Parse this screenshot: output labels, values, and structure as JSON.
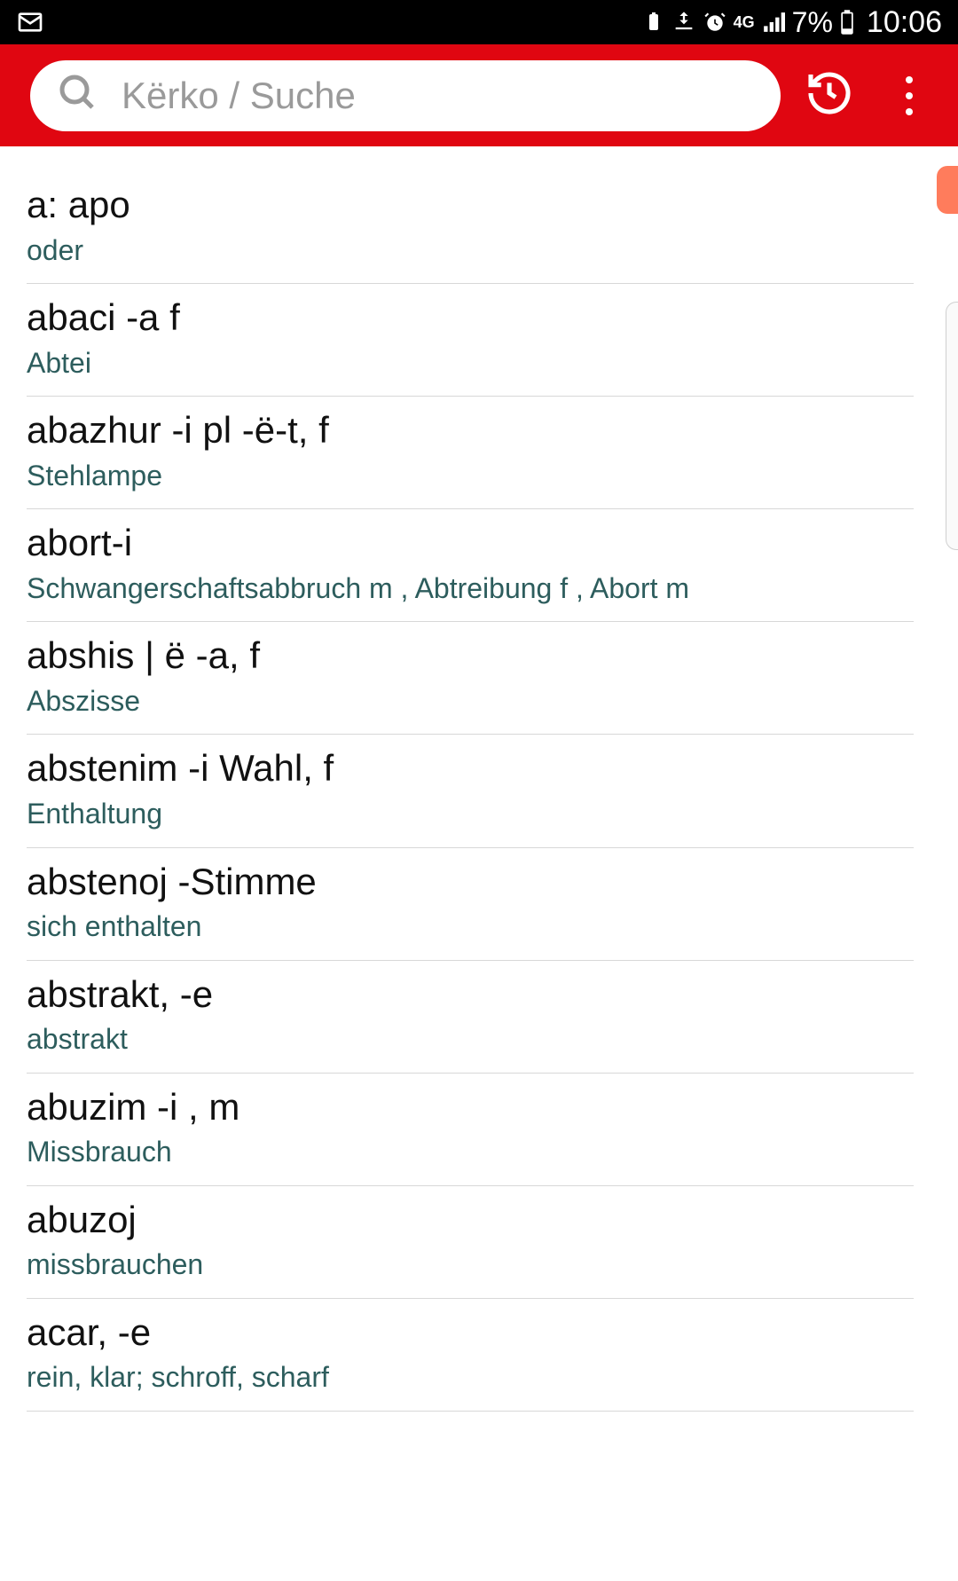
{
  "status": {
    "time": "10:06",
    "battery": "7%",
    "net": "4G",
    "icons": [
      "mail",
      "battery-saver",
      "vibrate",
      "alarm",
      "4g",
      "signal",
      "battery"
    ]
  },
  "search": {
    "placeholder": "Kërko / Suche"
  },
  "entries": [
    {
      "word": "a: apo",
      "def": "oder"
    },
    {
      "word": "abaci -a  f",
      "def": "Abtei"
    },
    {
      "word": "abazhur -i pl -ë-t, f",
      "def": "Stehlampe"
    },
    {
      "word": "abort-i",
      "def": "Schwangerschaftsabbruch m , Abtreibung f , Abort m"
    },
    {
      "word": "abshis | ë -a, f",
      "def": "Abszisse"
    },
    {
      "word": "abstenim -i Wahl, f",
      "def": "Enthaltung"
    },
    {
      "word": "abstenoj -Stimme",
      "def": "sich enthalten"
    },
    {
      "word": "abstrakt, -e",
      "def": "abstrakt"
    },
    {
      "word": "abuzim -i , m",
      "def": "Missbrauch"
    },
    {
      "word": "abuzoj",
      "def": "missbrauchen"
    },
    {
      "word": "acar, -e",
      "def": "rein, klar;  schroff, scharf"
    }
  ]
}
